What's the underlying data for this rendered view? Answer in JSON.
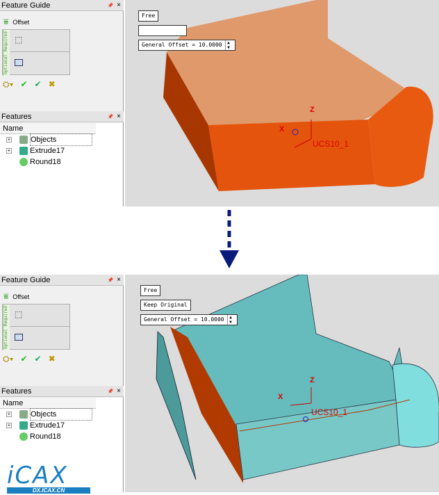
{
  "top": {
    "guide": {
      "title": "Feature Guide",
      "pin": "📌",
      "close": "×",
      "command": "Offset",
      "required": "Required",
      "optional": "Optional"
    },
    "features": {
      "title": "Features",
      "column": "Name",
      "items": [
        "Objects",
        "Extrude17",
        "Round18"
      ]
    },
    "viewport": {
      "mode": "Free",
      "option": "",
      "offset": "General Offset = 10.0000",
      "ucs": "UCS10_1",
      "x": "X",
      "z": "Z"
    },
    "colors": {
      "face": "#e0996a",
      "side": "#b13a00",
      "bright": "#f15f10"
    }
  },
  "bottom": {
    "guide": {
      "title": "Feature Guide",
      "pin": "📌",
      "close": "×",
      "command": "Offset",
      "required": "Required",
      "optional": "Optional"
    },
    "features": {
      "title": "Features",
      "column": "Name",
      "items": [
        "Objects",
        "Extrude17",
        "Round18"
      ]
    },
    "viewport": {
      "mode": "Free",
      "option": "Keep Original",
      "offset": "General Offset = 10.0000",
      "ucs": "UCS10_1",
      "x": "X",
      "z": "Z"
    },
    "colors": {
      "face": "#66bcbc",
      "side": "#b13a00"
    }
  },
  "watermark": {
    "logo": "ICAX",
    "url": "DX.ICAX.CN"
  }
}
